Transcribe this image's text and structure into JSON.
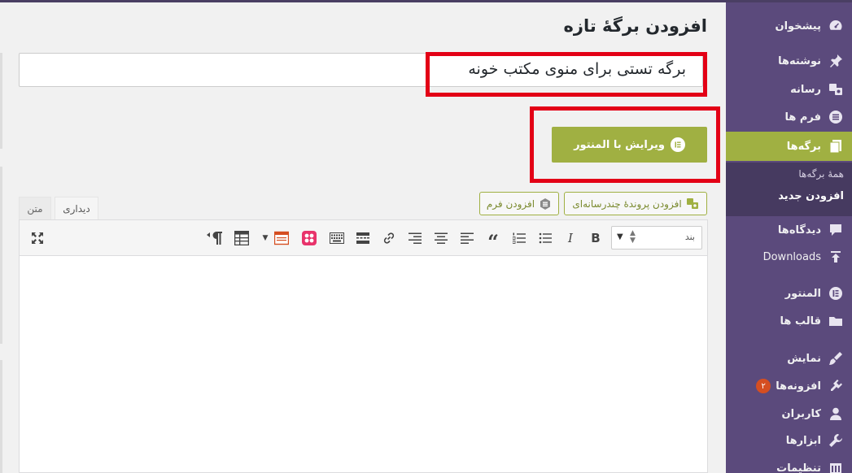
{
  "sidebar": {
    "items": [
      {
        "label": "پیشخوان",
        "icon": "dashboard-icon"
      },
      {
        "label": "نوشته‌ها",
        "icon": "pin-icon"
      },
      {
        "label": "رسانه",
        "icon": "media-icon"
      },
      {
        "label": "فرم ها",
        "icon": "forms-icon"
      },
      {
        "label": "برگه‌ها",
        "icon": "pages-icon"
      },
      {
        "label": "دیدگاه‌ها",
        "icon": "comments-icon"
      },
      {
        "label": "Downloads",
        "icon": "download-icon"
      },
      {
        "label": "المنتور",
        "icon": "elementor-icon"
      },
      {
        "label": "قالب ها",
        "icon": "folder-icon"
      },
      {
        "label": "نمایش",
        "icon": "appearance-icon"
      },
      {
        "label": "افزونه‌ها",
        "icon": "plugins-icon",
        "badge": "۲"
      },
      {
        "label": "کاربران",
        "icon": "users-icon"
      },
      {
        "label": "ابزارها",
        "icon": "tools-icon"
      },
      {
        "label": "تنظیمات",
        "icon": "settings-icon"
      }
    ],
    "submenu": {
      "all_pages": "همهٔ برگه‌ها",
      "add_new": "افزودن جدید"
    }
  },
  "main": {
    "page_title": "افزودن برگهٔ تازه",
    "title_value": "برگه تستی برای منوی مکتب خونه",
    "elementor_button": "ویرایش با المنتور",
    "media_buttons": {
      "add_media": "افزودن پروندهٔ چندرسانه‌ای",
      "add_form": "افزودن فرم"
    },
    "tabs": {
      "visual": "دیداری",
      "text": "متن"
    },
    "format_select": "بند"
  },
  "colors": {
    "sidebar": "#5b4a7c",
    "accent": "#a0b042",
    "highlight_box": "#e30016"
  }
}
